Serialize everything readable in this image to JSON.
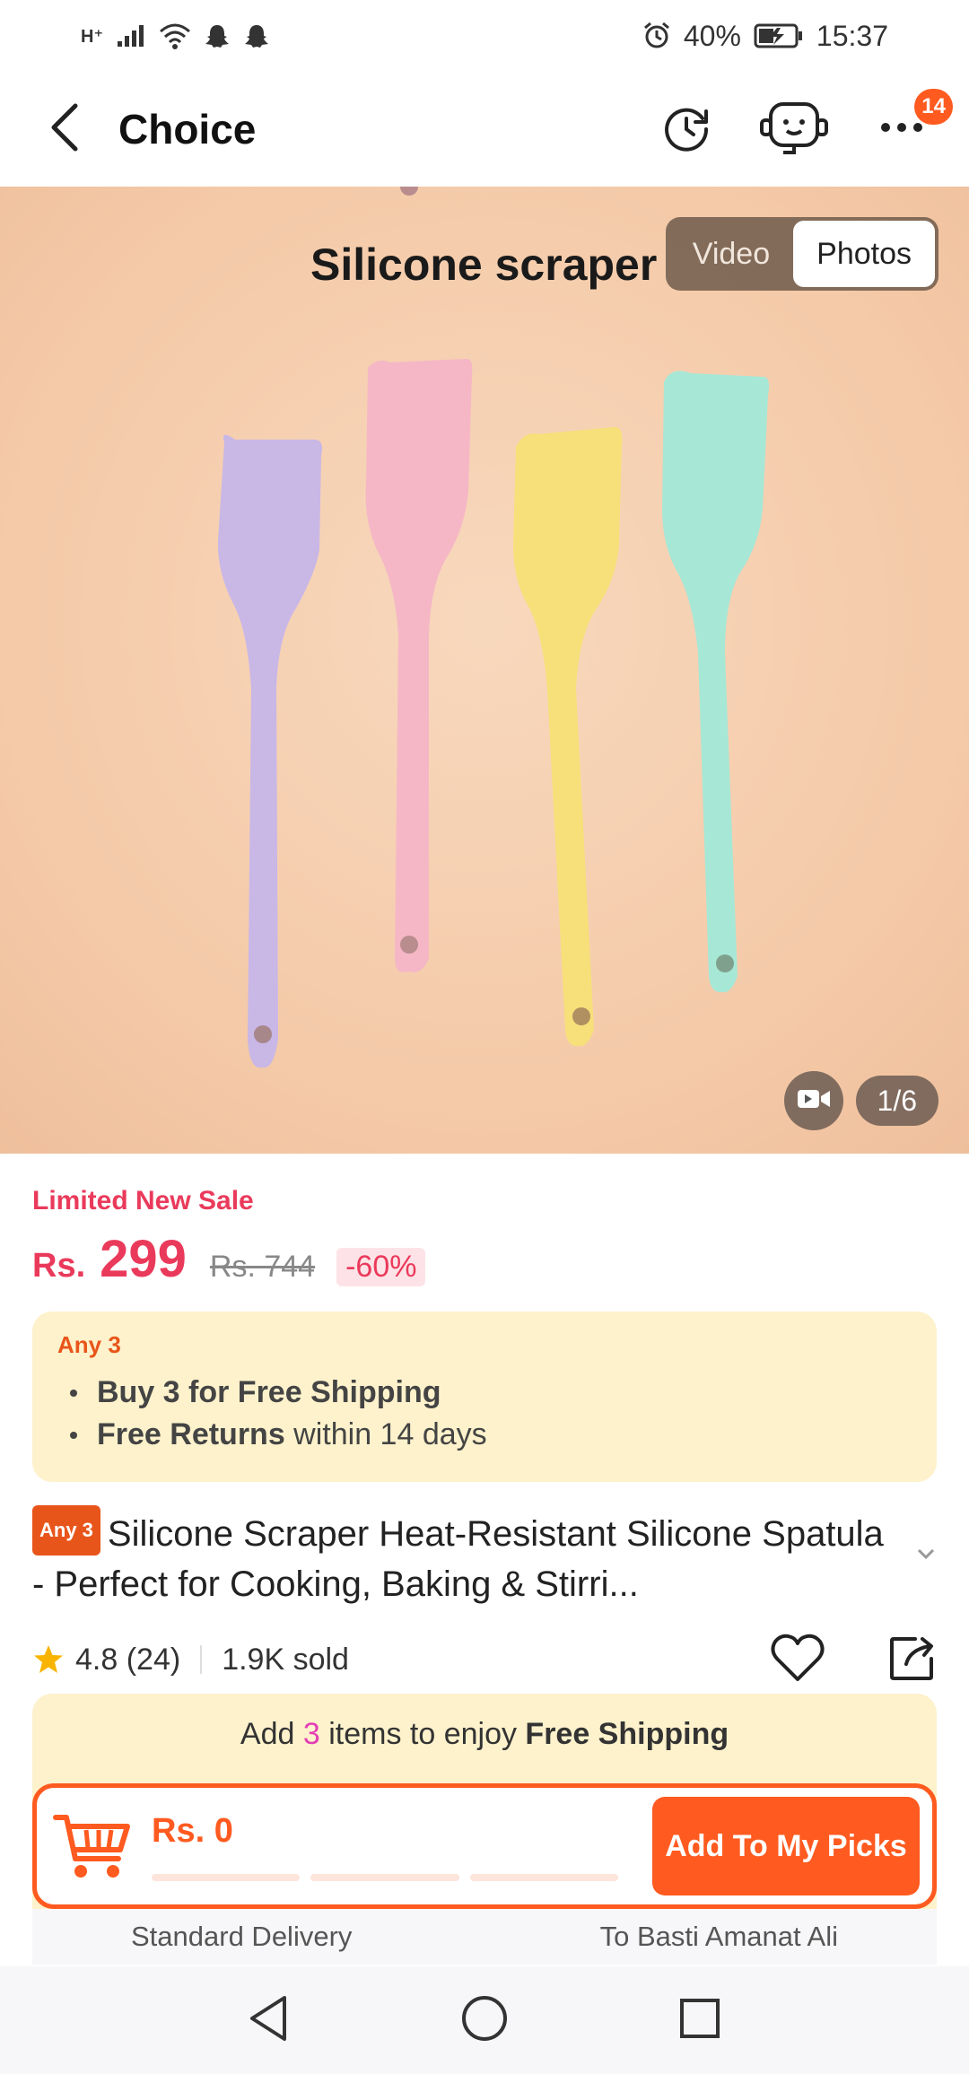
{
  "status_bar": {
    "network": "H⁺",
    "battery": "40%",
    "time": "15:37"
  },
  "header": {
    "title": "Choice",
    "notification_count": "14",
    "icons": [
      "back-arrow-icon",
      "history-icon",
      "customer-service-icon",
      "more-icon"
    ]
  },
  "hero": {
    "caption": "Silicone scraper",
    "media_options": [
      "Video",
      "Photos"
    ],
    "active_media": "Photos",
    "counter": "1/6",
    "colors": {
      "background": "#f4c9a7",
      "spatula_purple": "#c9b7e6",
      "spatula_pink": "#f5b7c6",
      "spatula_yellow": "#f7e07a",
      "spatula_mint": "#a7e7d6"
    }
  },
  "pricing": {
    "sale_label": "Limited New Sale",
    "currency": "Rs.",
    "price": "299",
    "original_price": "Rs. 744",
    "discount": "-60%"
  },
  "promo": {
    "tag": "Any 3",
    "items": [
      {
        "bold": "Buy 3 for  Free Shipping",
        "rest": ""
      },
      {
        "bold": "Free Returns",
        "rest": " within 14 days"
      }
    ]
  },
  "product": {
    "tag": "Any 3",
    "title": "Silicone Scraper Heat-Resistant Silicone Spatula - Perfect for Cooking, Baking & Stirri...",
    "rating": "4.8",
    "reviews": "(24)",
    "sold": "1.9K sold"
  },
  "shipping_panel": {
    "prefix": "Add ",
    "count": "3",
    "middle": " items to enjoy ",
    "emphasis": "Free Shipping",
    "cart_total": "Rs. 0",
    "progress_filled": 0,
    "button_label": "Add To My Picks"
  },
  "delivery": {
    "left": "Standard Delivery",
    "right": "To Basti Amanat Ali"
  },
  "brand_colors": {
    "accent": "#ff5a1f",
    "price": "#ea3a5b",
    "promo_bg": "#fdf2cc"
  }
}
